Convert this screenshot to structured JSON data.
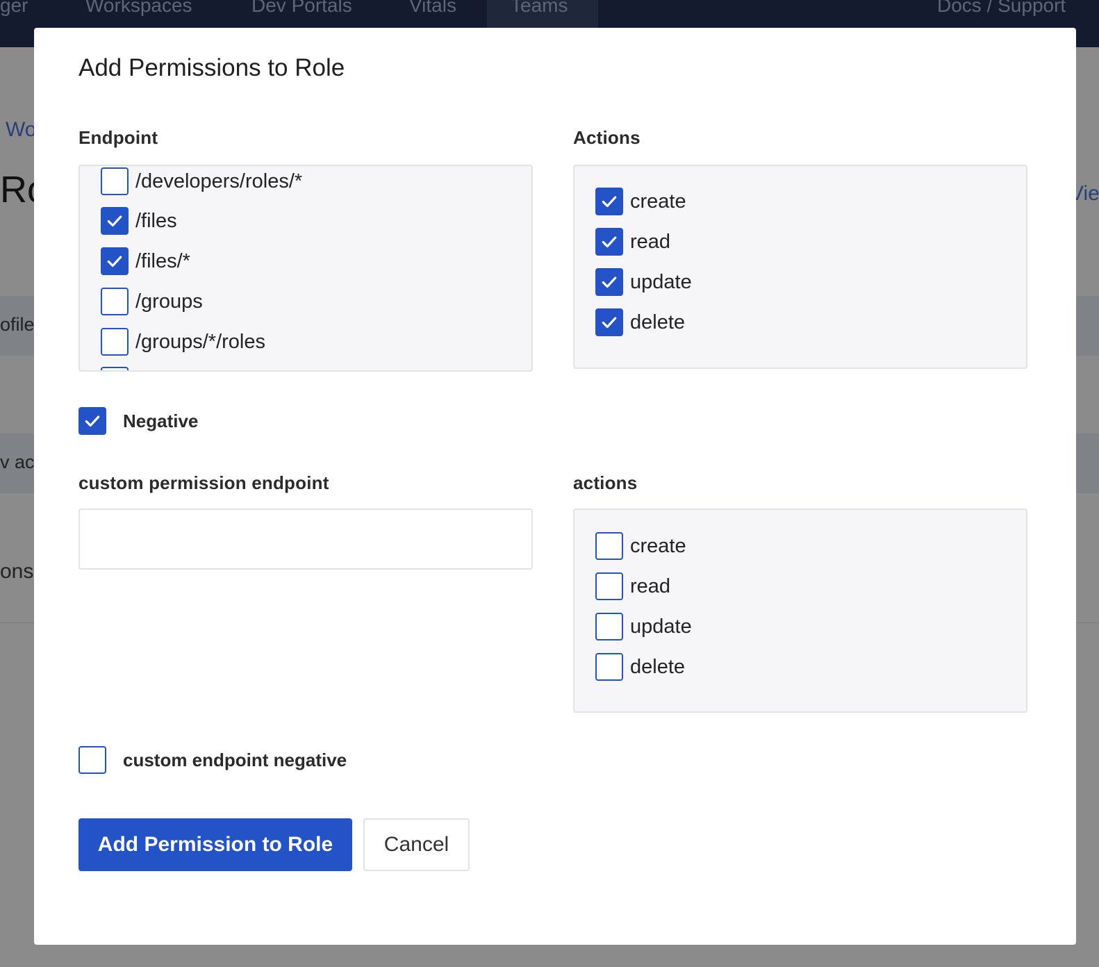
{
  "background": {
    "nav": {
      "brand_fragment": "ger",
      "items": [
        "Workspaces",
        "Dev Portals",
        "Vitals",
        "Teams"
      ],
      "active": "Teams",
      "right_link": "Docs / Support"
    },
    "breadcrumb_fragment": "Wo",
    "heading_fragment": "Ro",
    "right_fragment": "Vie",
    "row_fragments": [
      "ofile",
      "v acc",
      "ons"
    ]
  },
  "modal": {
    "title": "Add Permissions to Role",
    "endpoint": {
      "label": "Endpoint",
      "options": [
        {
          "label": "/developers/roles/*",
          "checked": false
        },
        {
          "label": "/files",
          "checked": true
        },
        {
          "label": "/files/*",
          "checked": true
        },
        {
          "label": "/groups",
          "checked": false
        },
        {
          "label": "/groups/*/roles",
          "checked": false
        }
      ]
    },
    "actions": {
      "label": "Actions",
      "options": [
        {
          "label": "create",
          "checked": true
        },
        {
          "label": "read",
          "checked": true
        },
        {
          "label": "update",
          "checked": true
        },
        {
          "label": "delete",
          "checked": true
        }
      ]
    },
    "negative": {
      "label": "Negative",
      "checked": true
    },
    "custom_endpoint": {
      "label": "custom permission endpoint",
      "value": "",
      "placeholder": ""
    },
    "custom_actions": {
      "label": "actions",
      "options": [
        {
          "label": "create",
          "checked": false
        },
        {
          "label": "read",
          "checked": false
        },
        {
          "label": "update",
          "checked": false
        },
        {
          "label": "delete",
          "checked": false
        }
      ]
    },
    "custom_negative": {
      "label": "custom endpoint negative",
      "checked": false
    },
    "submit_label": "Add Permission to Role",
    "cancel_label": "Cancel"
  },
  "colors": {
    "accent": "#2453c8",
    "nav_bg": "#141b2e",
    "overlay": "#8b8b8b"
  }
}
